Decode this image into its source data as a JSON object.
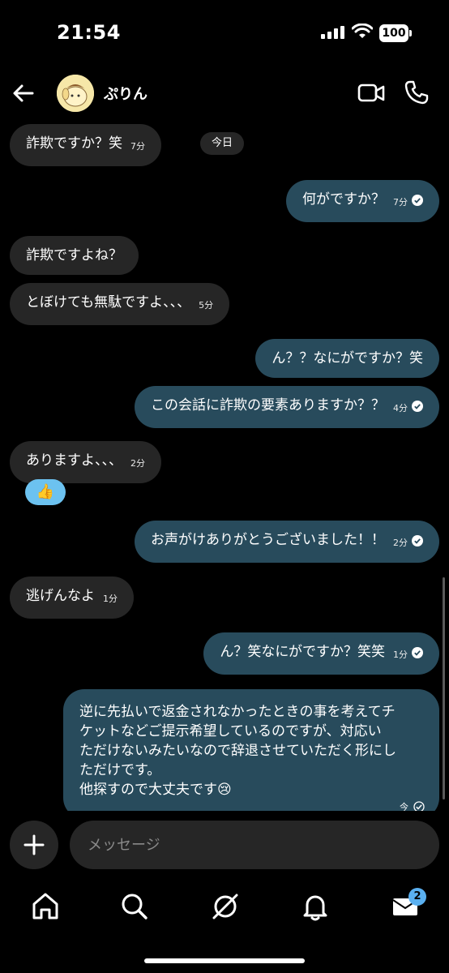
{
  "status": {
    "time": "21:54",
    "battery": "100"
  },
  "header": {
    "contact_name": "ぷりん"
  },
  "date_separator": "今日",
  "messages": [
    {
      "dir": "in",
      "text": "詐欺ですか？笑",
      "time": "7分"
    },
    {
      "dir": "out",
      "text": "何がですか？",
      "time": "7分"
    },
    {
      "dir": "in",
      "text": "詐欺ですよね？",
      "time": ""
    },
    {
      "dir": "in",
      "text": "とぼけても無駄ですよ、、、",
      "time": "5分"
    },
    {
      "dir": "out",
      "text": "ん？？なにがですか？笑",
      "time": ""
    },
    {
      "dir": "out",
      "text": "この会話に詐欺の要素ありますか？？",
      "time": "4分"
    },
    {
      "dir": "in",
      "text": "ありますよ、、、",
      "time": "2分"
    },
    {
      "dir": "out",
      "text": "お声がけありがとうございました！！",
      "time": "2分"
    },
    {
      "dir": "in",
      "text": "逃げんなよ",
      "time": "1分"
    },
    {
      "dir": "out",
      "text": "ん？笑なにがですか？笑笑",
      "time": "1分"
    },
    {
      "dir": "out",
      "lines": [
        "逆に先払いで返金されなかったときの事を考えてチ",
        "ケットなどご提示希望しているのですが、対応い",
        "ただけないみたいなので辞退させていただく形にし",
        "ただけです。",
        "他探すので大丈夫です😢"
      ],
      "time": "今"
    }
  ],
  "reaction": {
    "emoji": "👍"
  },
  "composer": {
    "placeholder": "メッセージ"
  },
  "nav": {
    "messages_badge": "2"
  },
  "colors": {
    "incoming_bubble": "#262626",
    "outgoing_bubble": "#284b5c",
    "badge": "#5ab0f0"
  }
}
